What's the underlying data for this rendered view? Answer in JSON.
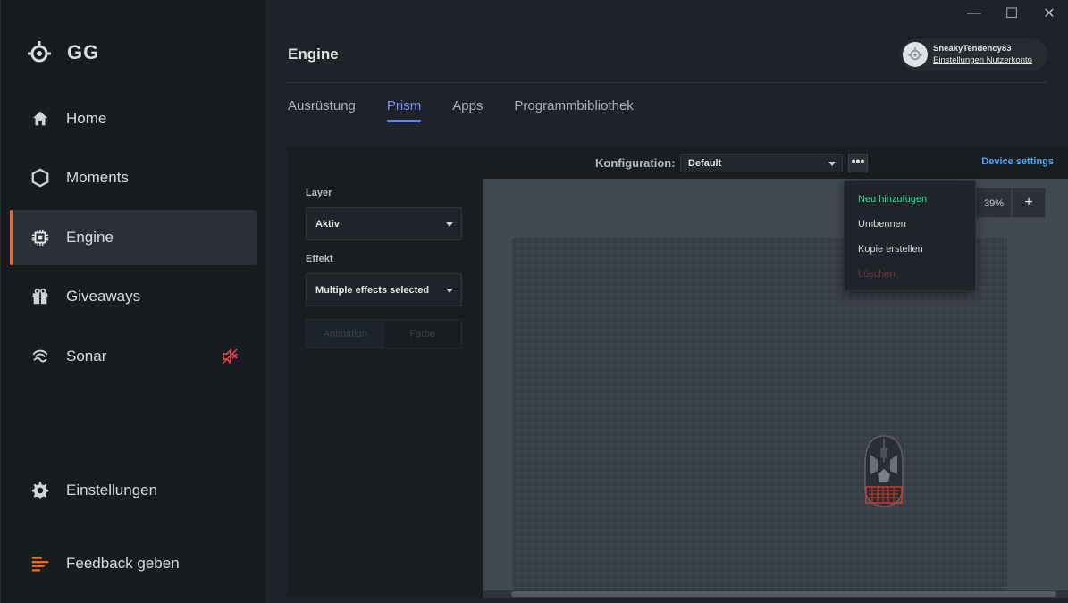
{
  "app": {
    "brand": "GG"
  },
  "window": {
    "minimize": "—",
    "maximize": "☐",
    "close": "✕"
  },
  "sidebar": {
    "items": [
      {
        "label": "Home",
        "icon": "home-icon"
      },
      {
        "label": "Moments",
        "icon": "hexagon-icon"
      },
      {
        "label": "Engine",
        "icon": "chip-icon",
        "active": true
      },
      {
        "label": "Giveaways",
        "icon": "gift-icon"
      },
      {
        "label": "Sonar",
        "icon": "sonar-icon",
        "badge_icon": "muted-speaker-icon"
      }
    ],
    "bottom": [
      {
        "label": "Einstellungen",
        "icon": "gear-icon"
      },
      {
        "label": "Feedback geben",
        "icon": "feedback-icon"
      }
    ]
  },
  "header": {
    "title": "Engine",
    "account": {
      "username": "SneakyTendency83",
      "link": "Einstellungen Nutzerkonto"
    }
  },
  "tabs": [
    {
      "label": "Ausrüstung"
    },
    {
      "label": "Prism",
      "active": true
    },
    {
      "label": "Apps"
    },
    {
      "label": "Programmbibliothek"
    }
  ],
  "config": {
    "label": "Konfiguration:",
    "selected": "Default",
    "more": "•••",
    "device_settings": "Device settings"
  },
  "controls": {
    "layer_label": "Layer",
    "layer_value": "Aktiv",
    "effect_label": "Effekt",
    "effect_value": "Multiple effects selected",
    "segment": [
      "Animation",
      "Farbe"
    ]
  },
  "zoom": {
    "value": "39%",
    "plus": "+"
  },
  "menu": {
    "items": [
      "Neu hinzufügen",
      "Umbennen",
      "Kopie erstellen",
      "Löschen"
    ]
  },
  "colors": {
    "accent_orange": "#f26b1d",
    "tab_active": "#7b8cff",
    "link_blue": "#4aa6f5",
    "menu_new": "#2fd9a4",
    "menu_delete": "#6b3a3d",
    "mute_red": "#e0454f"
  }
}
